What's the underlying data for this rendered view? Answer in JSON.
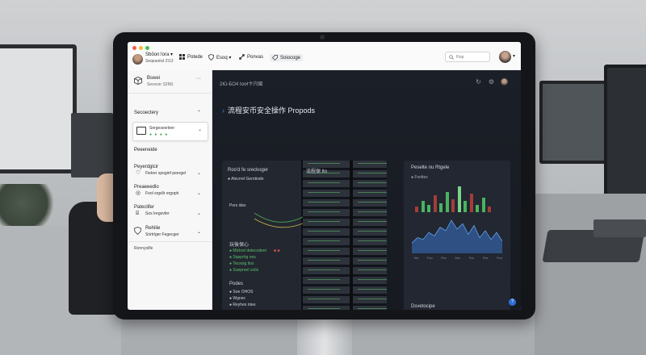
{
  "titlebar": {
    "title": "Sbōon:!ora ▾",
    "subtitle": "Seqeaoiist 2ī13",
    "menu": [
      {
        "label": "Potede",
        "icon": "grid-icon"
      },
      {
        "label": "Esoq ▾",
        "icon": "shield-icon"
      },
      {
        "label": "Ponvas",
        "icon": "link-icon"
      },
      {
        "label": "Soiocoge",
        "icon": "tag-icon"
      }
    ],
    "search_placeholder": "Fisp"
  },
  "sidebar": {
    "header": {
      "title": "Bswei",
      "subtitle": "Sevvcer S2NS"
    },
    "section_title": "Secoectery",
    "card": {
      "label": "Sergesesrleer",
      "status": "● ● ● ●"
    },
    "items": [
      {
        "heading": "Peeeneide",
        "label": "",
        "icon": "cube-icon"
      },
      {
        "heading": "Peyerdglcir",
        "label": "Fietrer spoginf peergel",
        "icon": "heart-icon"
      },
      {
        "heading": "Preaeeedlo",
        "label": "Fool srgsllr ergoph",
        "icon": "pin-icon"
      },
      {
        "heading": "Pateclifer",
        "label": "Sos Iregovfer",
        "icon": "key-icon"
      },
      {
        "heading": "Rehilie",
        "label": "Srirtrlger Fegecger",
        "icon": "shield-icon"
      }
    ],
    "footer": "Ronnysifle"
  },
  "main": {
    "breadcrumb": "2Ю-БО4 tooɫ卞宍國",
    "heading": "流程安币安全操作 Propods",
    "panel_left": {
      "title": "Roo'd fe sreckoger",
      "subtitle": "● Alecrrel Gerotiodo",
      "section1": "Pors idss",
      "section2": "玩後保心",
      "list1": [
        "● Micloel detecodeel",
        "● Sqoprhg oos",
        "● Tecsoig ltos",
        "● Suepreel octis"
      ],
      "section3": "Podes",
      "list2": [
        "● Soe OHOS",
        "● Wgnec",
        "● Reyhes ntee"
      ],
      "rack_label": "流程保 lto"
    },
    "panel_right": {
      "title": "Peselte nu Rtgele",
      "subtitle": "● Fonltes",
      "axis": [
        "Toe",
        "Fso",
        "Fec",
        "Sov",
        "Foc",
        "Foe",
        "Feo"
      ],
      "section": "Dsvetocipe"
    },
    "help": "?"
  },
  "colors": {
    "accent": "#3d82e6",
    "green": "#4bb35e",
    "red": "#d2574a",
    "dark_bg": "#1b1f27"
  },
  "chart_data": {
    "type": "bar",
    "values": [
      3,
      6,
      4,
      9,
      5,
      11,
      7,
      14,
      6,
      10,
      4,
      8,
      3
    ],
    "area_values": [
      6,
      9,
      8,
      12,
      10,
      15,
      13,
      19,
      14,
      17,
      11,
      16,
      9,
      13,
      8,
      12,
      7
    ]
  }
}
